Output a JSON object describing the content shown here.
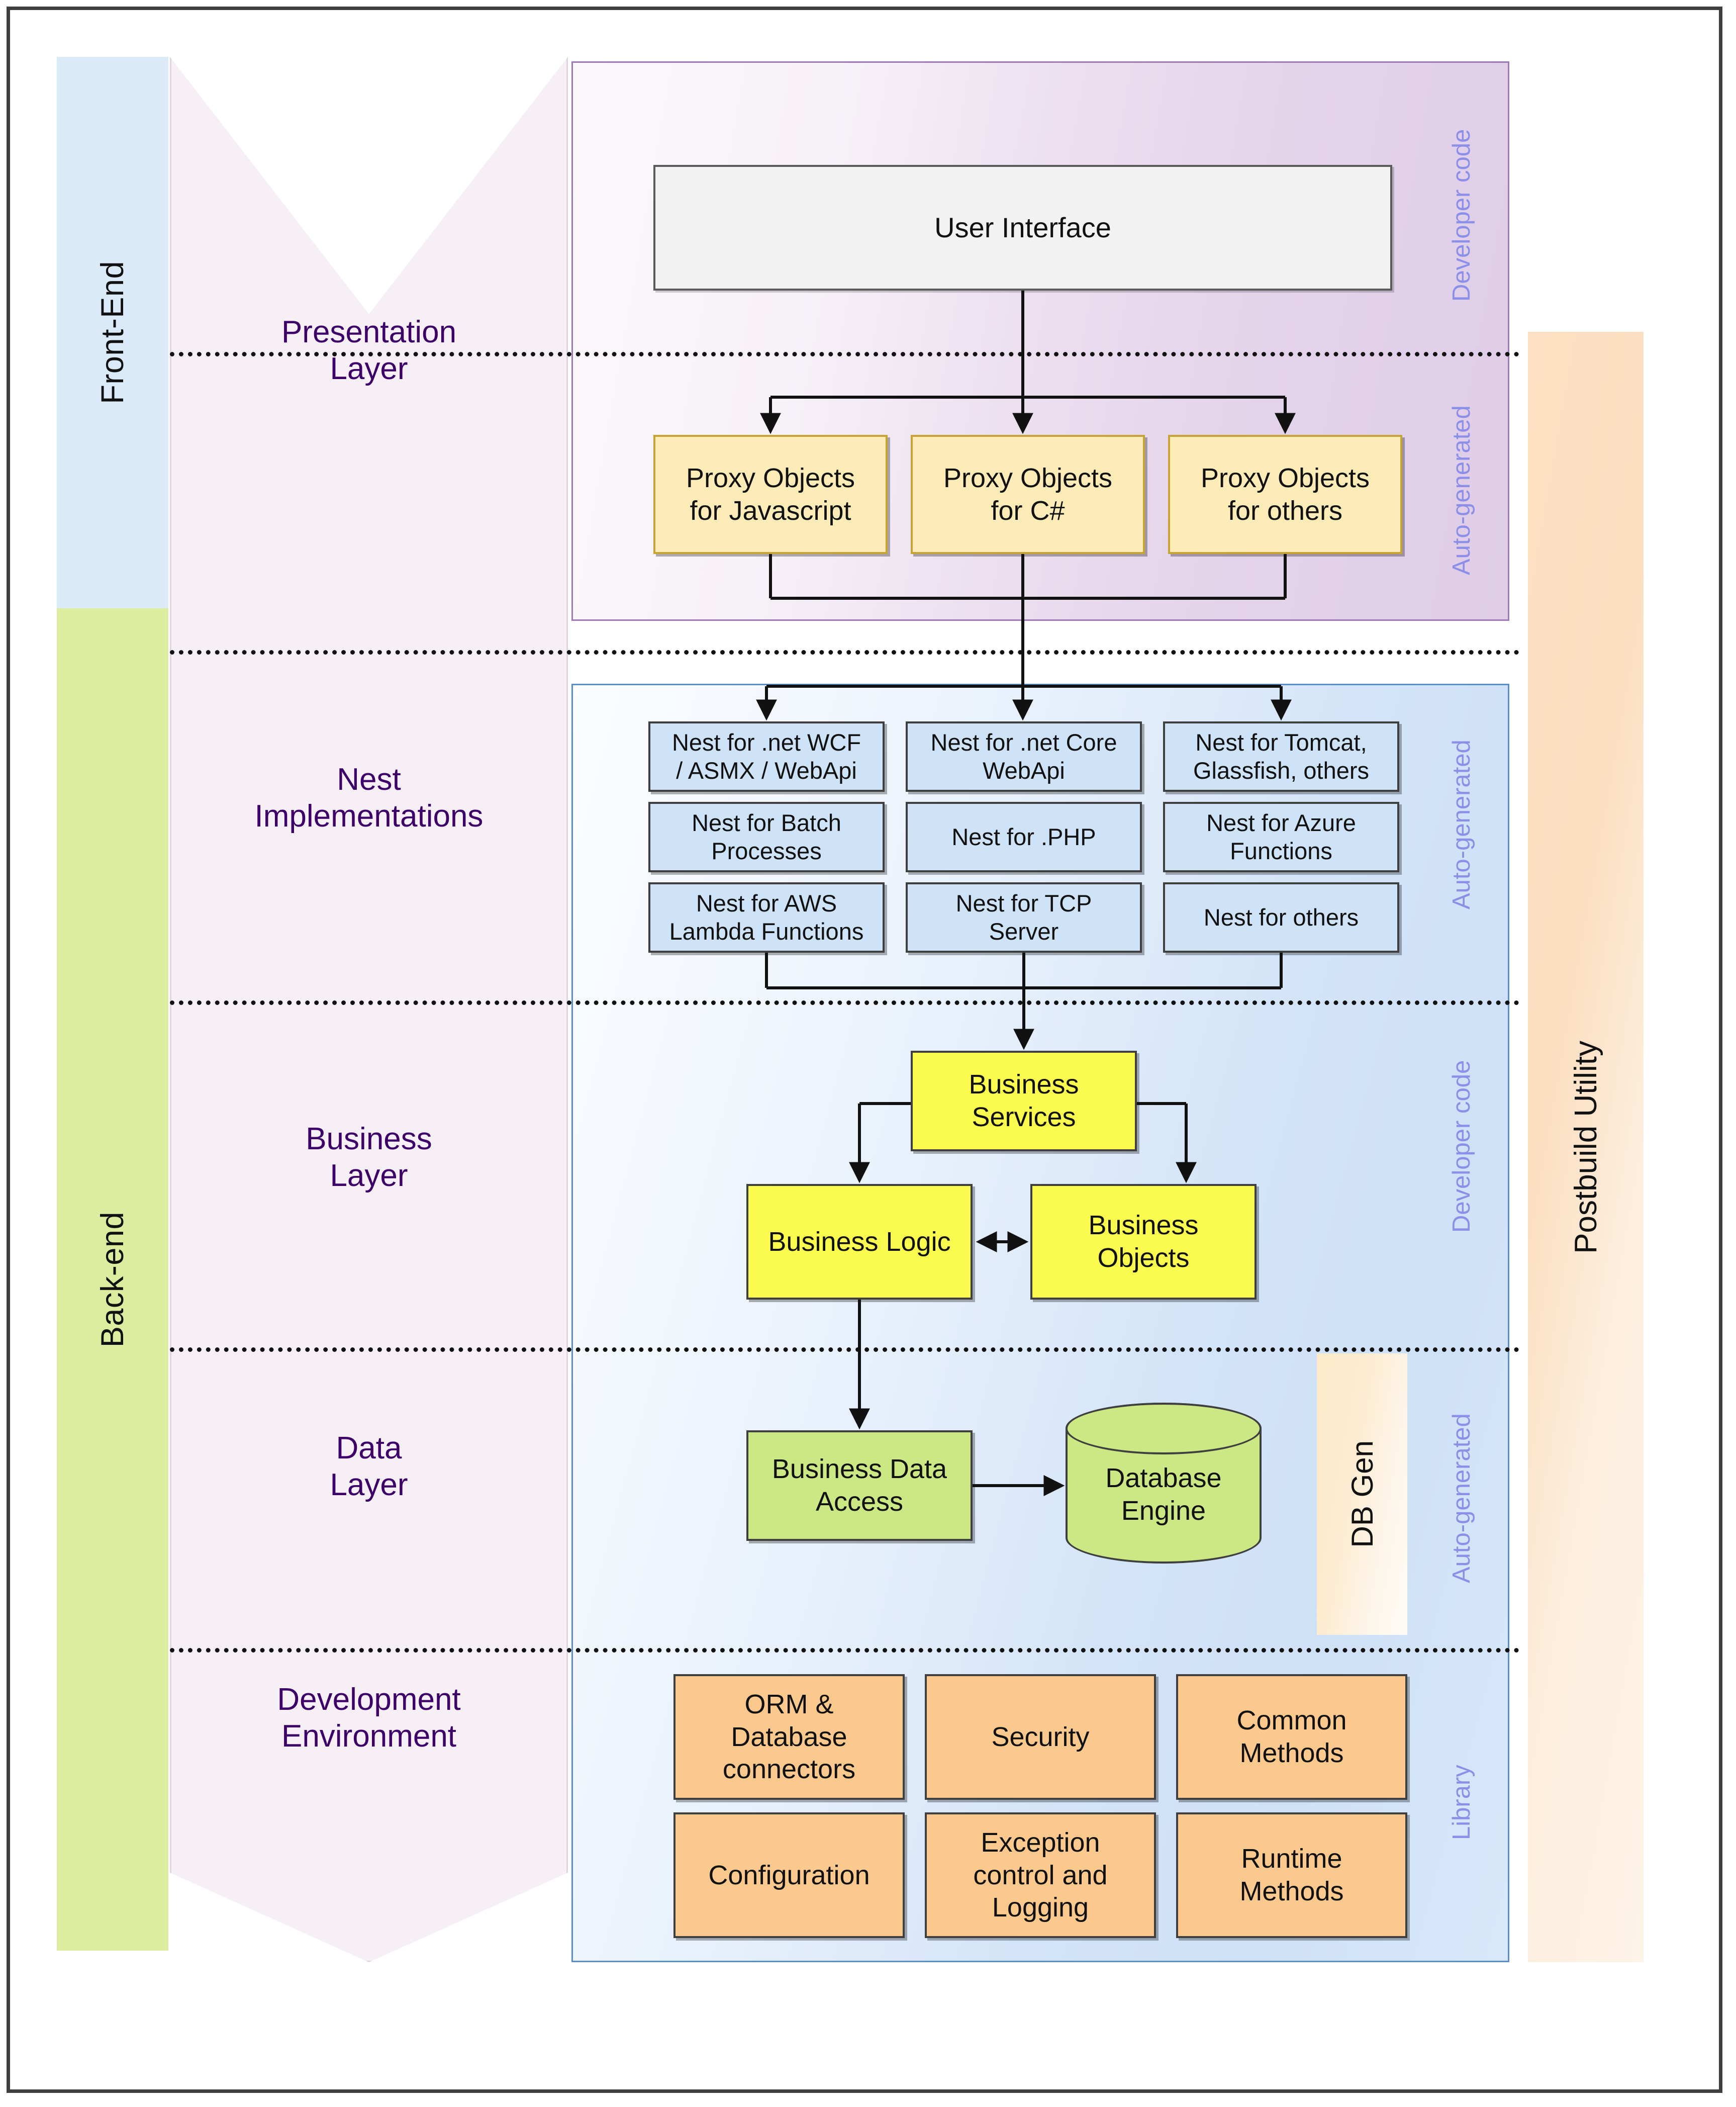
{
  "tiers": [
    {
      "label": "Front-End"
    },
    {
      "label": "Back-end"
    }
  ],
  "layers": [
    {
      "label": "Presentation\nLayer"
    },
    {
      "label": "Nest\nImplementations"
    },
    {
      "label": "Business\nLayer"
    },
    {
      "label": "Data\nLayer"
    },
    {
      "label": "Development\nEnvironment"
    }
  ],
  "presentation": {
    "user_interface": "User Interface",
    "proxies": [
      "Proxy Objects\nfor Javascript",
      "Proxy Objects\nfor C#",
      "Proxy Objects\nfor others"
    ],
    "side_notes": [
      "Developer code",
      "Auto-generated"
    ]
  },
  "nest": {
    "side_note": "Auto-generated",
    "items": [
      "Nest for .net WCF\n/ ASMX / WebApi",
      "Nest for .net Core\nWebApi",
      "Nest for Tomcat,\nGlassfish, others",
      "Nest for Batch\nProcesses",
      "Nest for .PHP",
      "Nest for Azure\nFunctions",
      "Nest for AWS\nLambda Functions",
      "Nest for TCP\nServer",
      "Nest for others"
    ]
  },
  "business": {
    "side_note": "Developer code",
    "services": "Business\nServices",
    "logic": "Business Logic",
    "objects": "Business\nObjects"
  },
  "data": {
    "side_note": "Auto-generated",
    "data_access": "Business Data\nAccess",
    "database": "Database\nEngine",
    "db_gen": "DB Gen"
  },
  "development": {
    "side_note": "Library",
    "items": [
      "ORM &\nDatabase\nconnectors",
      "Security",
      "Common\nMethods",
      "Configuration",
      "Exception\ncontrol and\nLogging",
      "Runtime\nMethods"
    ]
  },
  "postbuild": {
    "label": "Postbuild Utility"
  },
  "colors": {
    "frontend_band": "#daeaf9",
    "backend_band": "#dceda0",
    "chevron": "#f6eff6",
    "layer_text": "#3d0068",
    "purple_panel_border": "#9f79b8",
    "blue_panel_border": "#5b8fc9",
    "side_note_text": "#8b8fe8",
    "proxy_fill": "#fdecb8",
    "nest_fill": "#cfe3f8",
    "business_fill": "#fbfb4f",
    "data_fill": "#cbe884",
    "library_fill": "#fbc98d",
    "postbuild_fill": "#fbe0c3"
  }
}
